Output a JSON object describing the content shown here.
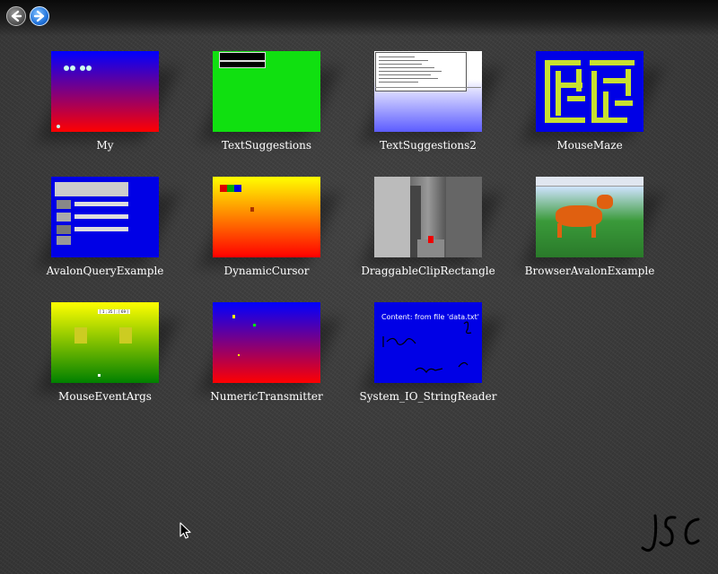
{
  "toolbar": {
    "back_icon": "arrow-left-icon",
    "forward_icon": "arrow-right-icon"
  },
  "examples": [
    {
      "label": "My"
    },
    {
      "label": "TextSuggestions"
    },
    {
      "label": "TextSuggestions2"
    },
    {
      "label": "MouseMaze"
    },
    {
      "label": "AvalonQueryExample"
    },
    {
      "label": "DynamicCursor"
    },
    {
      "label": "DraggableClipRectangle"
    },
    {
      "label": "BrowserAvalonExample"
    },
    {
      "label": "MouseEventArgs"
    },
    {
      "label": "NumericTransmitter"
    },
    {
      "label": "System_IO_StringReader"
    }
  ],
  "thumbs": {
    "stringreader_content": "Content: from file 'data.txt'",
    "mouseeventargs_coords": "[ 1 ; 35 ] ; [ 69 ]"
  },
  "signature": "JSC",
  "colors": {
    "background": "#3a3a3a",
    "label": "#ffffff",
    "forward_button": "#1d6fd8"
  }
}
